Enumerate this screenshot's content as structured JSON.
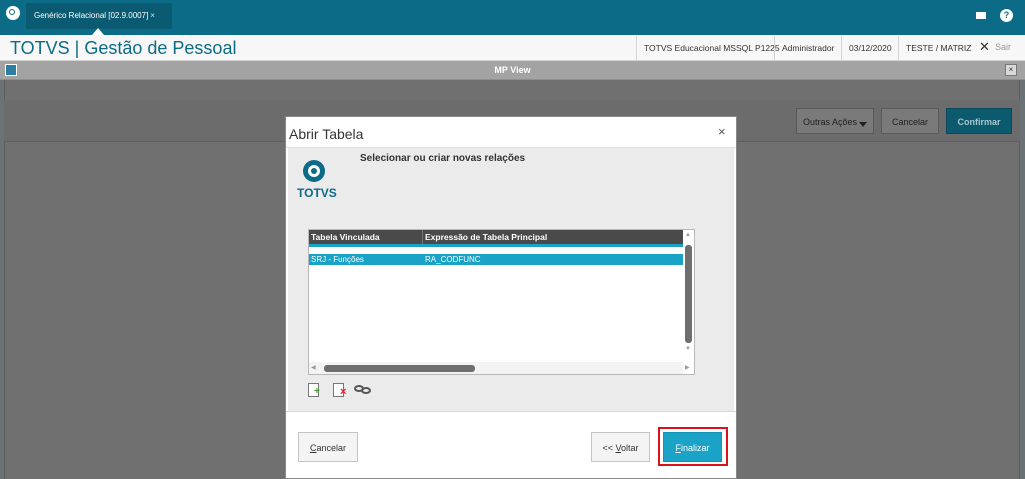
{
  "top_tab": {
    "title": "Genérico Relacional [02.9.0007]",
    "close": "×"
  },
  "header": {
    "brand": "TOTVS | Gestão de Pessoal",
    "environment": "TOTVS Educacional MSSQL P1225",
    "user": "Administrador",
    "date": "03/12/2020",
    "branch": "TESTE / MATRIZ",
    "exit": "Sair"
  },
  "mpview": {
    "title": "MP View"
  },
  "toolbar": {
    "more_actions": "Outras Ações",
    "cancel": "Cancelar",
    "confirm": "Confirmar"
  },
  "dialog": {
    "title": "Abrir Tabela",
    "close": "×",
    "logo_text": "TOTVS",
    "subtitle": "Selecionar ou criar novas relações",
    "grid": {
      "columns": [
        "Tabela Vinculada",
        "Expressão de Tabela Principal"
      ],
      "rows": [
        [
          "SRJ - Funções",
          "RA_CODFUNC"
        ]
      ]
    },
    "footer": {
      "cancel_first": "C",
      "cancel_rest": "ancelar",
      "back_prefix": "<< ",
      "back_first": "V",
      "back_rest": "oltar",
      "finish_first": "F",
      "finish_rest": "inalizar"
    }
  },
  "icons": [
    "totvs-logo-icon",
    "mail-icon",
    "help-icon",
    "add-relation-icon",
    "delete-relation-icon",
    "link-icon"
  ],
  "colors": {
    "accent": "#0c6b86",
    "primary_button": "#1aa3c6",
    "highlight": "#d8141b"
  }
}
